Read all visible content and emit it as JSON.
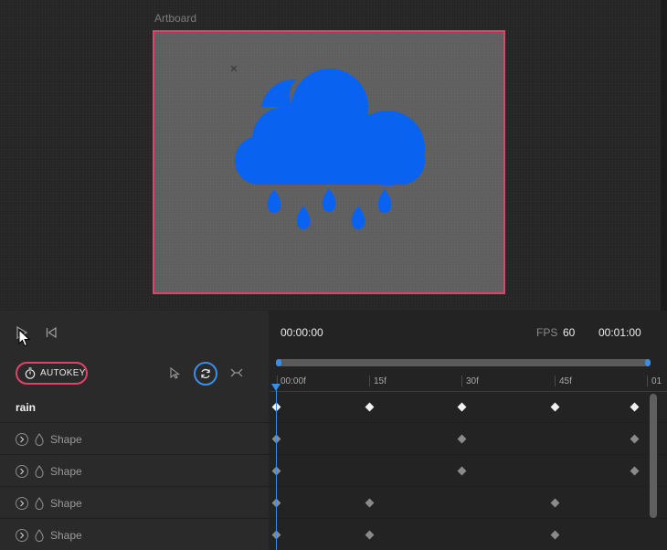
{
  "canvas": {
    "artboard_label": "Artboard",
    "icon_name": "cloud-rain-moon-icon",
    "colors": {
      "artboard_border": "#e0436a",
      "icon": "#0a63f0",
      "artboard_fill": "#5f5f5f"
    }
  },
  "timeline": {
    "controls": {
      "play_icon": "play-icon",
      "rewind_icon": "skip-to-start-icon",
      "autokey_label": "AUTOKEY",
      "autokey_icon": "stopwatch-icon",
      "select_icon": "pointer-icon",
      "loop_icon": "loop-icon",
      "pingpong_icon": "pingpong-icon"
    },
    "current_time": "00:00:00",
    "fps_label": "FPS",
    "fps_value": "60",
    "duration": "00:01:00",
    "ruler": [
      "00:00f",
      "15f",
      "30f",
      "45f",
      "01"
    ],
    "layers": {
      "title": "rain",
      "rows": [
        {
          "label": "Shape"
        },
        {
          "label": "Shape"
        },
        {
          "label": "Shape"
        },
        {
          "label": "Shape"
        }
      ]
    },
    "accent": "#3b8ee6"
  }
}
